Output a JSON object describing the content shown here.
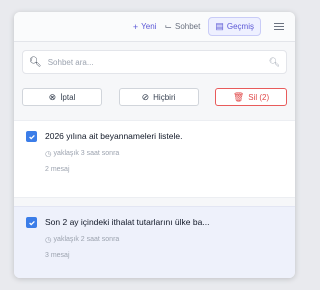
{
  "toolbar": {
    "new_label": "Yeni",
    "chat_label": "Sohbet",
    "history_label": "Geçmiş",
    "new_icon": "plus-icon",
    "chat_icon": "chat-icon",
    "history_icon": "history-icon",
    "menu_icon": "menu-icon"
  },
  "search": {
    "placeholder": "Sohbet ara...",
    "icon": "search-icon"
  },
  "actions": {
    "cancel_label": "İptal",
    "none_label": "Hiçbiri",
    "delete_label": "Sil (2)",
    "cancel_icon": "circle-x-icon",
    "none_icon": "circle-slash-icon",
    "delete_icon": "trash-icon"
  },
  "conversations": [
    {
      "title": "2026 yılına ait beyannameleri listele.",
      "time": "yaklaşık 3 saat sonra",
      "messages": "2 mesaj",
      "selected": true
    },
    {
      "title": "Son 2 ay içindeki ithalat tutarlarını ülke ba...",
      "time": "yaklaşık 2 saat sonra",
      "messages": "3 mesaj",
      "selected": true
    }
  ],
  "colors": {
    "accent": "#5b57d6",
    "checkbox": "#3b7de8",
    "danger": "#e04848"
  }
}
